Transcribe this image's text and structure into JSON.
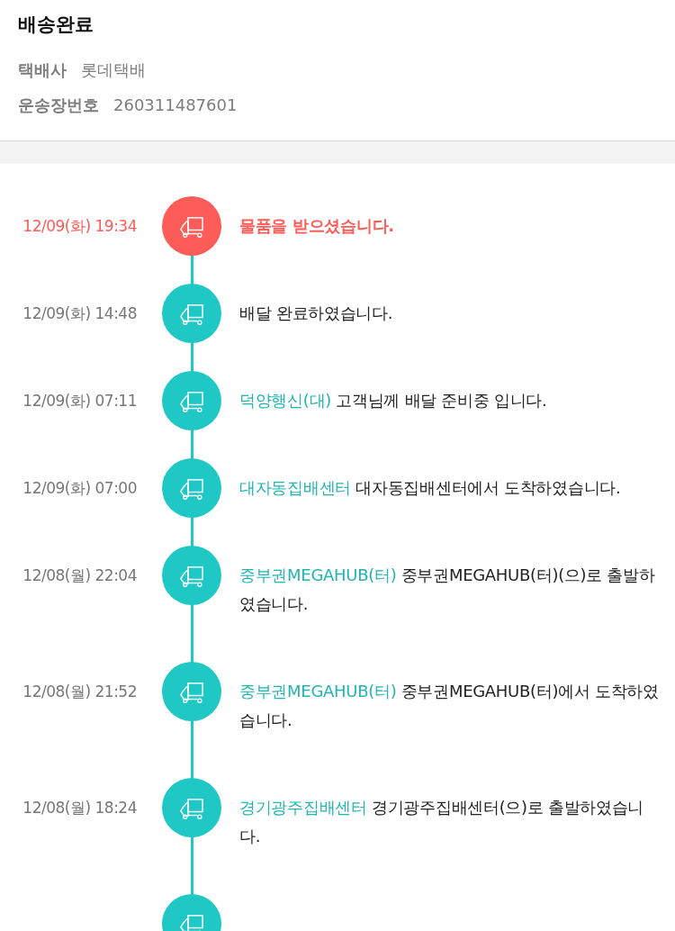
{
  "header": {
    "title": "배송완료",
    "fields": [
      {
        "label": "택배사",
        "value": "롯데택배"
      },
      {
        "label": "운송장번호",
        "value": "260311487601"
      }
    ]
  },
  "events": [
    {
      "time": "12/09(화) 19:34",
      "active": true,
      "message": "물품을 받으셨습니다."
    },
    {
      "time": "12/09(화) 14:48",
      "active": false,
      "message": "배달 완료하였습니다."
    },
    {
      "time": "12/09(화) 07:11",
      "active": false,
      "location": "덕양행신(대)",
      "message": "고객님께 배달 준비중 입니다."
    },
    {
      "time": "12/09(화) 07:00",
      "active": false,
      "location": "대자동집배센터",
      "message": "대자동집배센터에서 도착하였습니다."
    },
    {
      "time": "12/08(월) 22:04",
      "active": false,
      "location": "중부권MEGAHUB(터)",
      "message": "중부권MEGAHUB(터)(으)로 출발하였습니다."
    },
    {
      "time": "12/08(월) 21:52",
      "active": false,
      "location": "중부권MEGAHUB(터)",
      "message": "중부권MEGAHUB(터)에서 도착하였습니다."
    },
    {
      "time": "12/08(월) 18:24",
      "active": false,
      "location": "경기광주집배센터",
      "message": "경기광주집배센터(으)로 출발하였습니다."
    },
    {
      "active": false
    }
  ]
}
